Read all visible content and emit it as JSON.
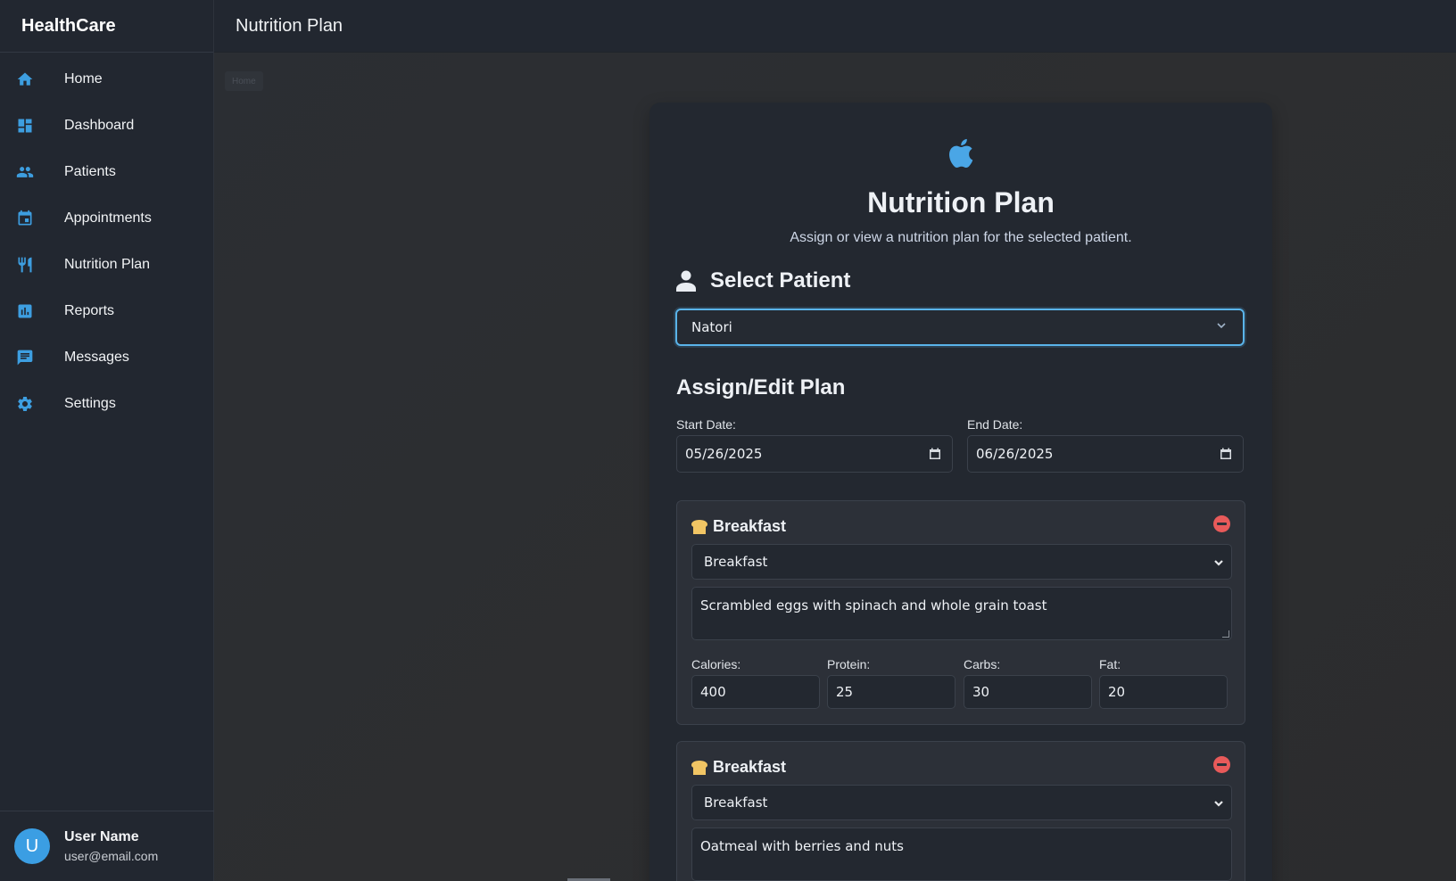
{
  "app": {
    "brand": "HealthCare",
    "page_title": "Nutrition Plan"
  },
  "sidebar": {
    "items": [
      {
        "label": "Home",
        "icon": "home-icon"
      },
      {
        "label": "Dashboard",
        "icon": "dashboard-icon"
      },
      {
        "label": "Patients",
        "icon": "people-icon"
      },
      {
        "label": "Appointments",
        "icon": "calendar-icon"
      },
      {
        "label": "Nutrition Plan",
        "icon": "utensils-icon"
      },
      {
        "label": "Reports",
        "icon": "bar-chart-icon"
      },
      {
        "label": "Messages",
        "icon": "message-icon"
      },
      {
        "label": "Settings",
        "icon": "gear-icon"
      }
    ],
    "user": {
      "initial": "U",
      "name": "User Name",
      "email": "user@email.com"
    }
  },
  "breadcrumb": {
    "label": "Home"
  },
  "card": {
    "title": "Nutrition Plan",
    "subtitle": "Assign or view a nutrition plan for the selected patient.",
    "select_patient_heading": "Select Patient",
    "selected_patient": "Natori",
    "assign_heading": "Assign/Edit Plan",
    "start_date_label": "Start Date:",
    "start_date": "05/26/2025",
    "end_date_label": "End Date:",
    "end_date": "06/26/2025"
  },
  "macro_labels": {
    "calories": "Calories:",
    "protein": "Protein:",
    "carbs": "Carbs:",
    "fat": "Fat:"
  },
  "meals": [
    {
      "heading": "Breakfast",
      "type": "Breakfast",
      "description": "Scrambled eggs with spinach and whole grain toast",
      "calories": "400",
      "protein": "25",
      "carbs": "30",
      "fat": "20"
    },
    {
      "heading": "Breakfast",
      "type": "Breakfast",
      "description": "Oatmeal with berries and nuts"
    }
  ],
  "colors": {
    "accent": "#3d9ee0",
    "remove": "#e85a5a",
    "meal_icon": "#f1c564"
  }
}
